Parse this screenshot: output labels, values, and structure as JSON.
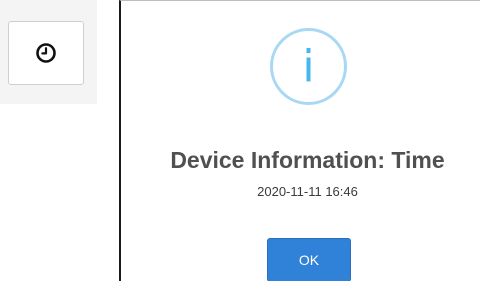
{
  "toolbar": {
    "clock_button_icon": "clock-icon"
  },
  "dialog": {
    "icon": "info-icon",
    "icon_glyph": "i",
    "title": "Device Information: Time",
    "value": "2020-11-11 16:46",
    "ok_label": "OK"
  },
  "colors": {
    "accent": "#3081d8",
    "info_ring": "#a8d8f3",
    "info_glyph": "#48b6ee",
    "title_text": "#505050"
  }
}
